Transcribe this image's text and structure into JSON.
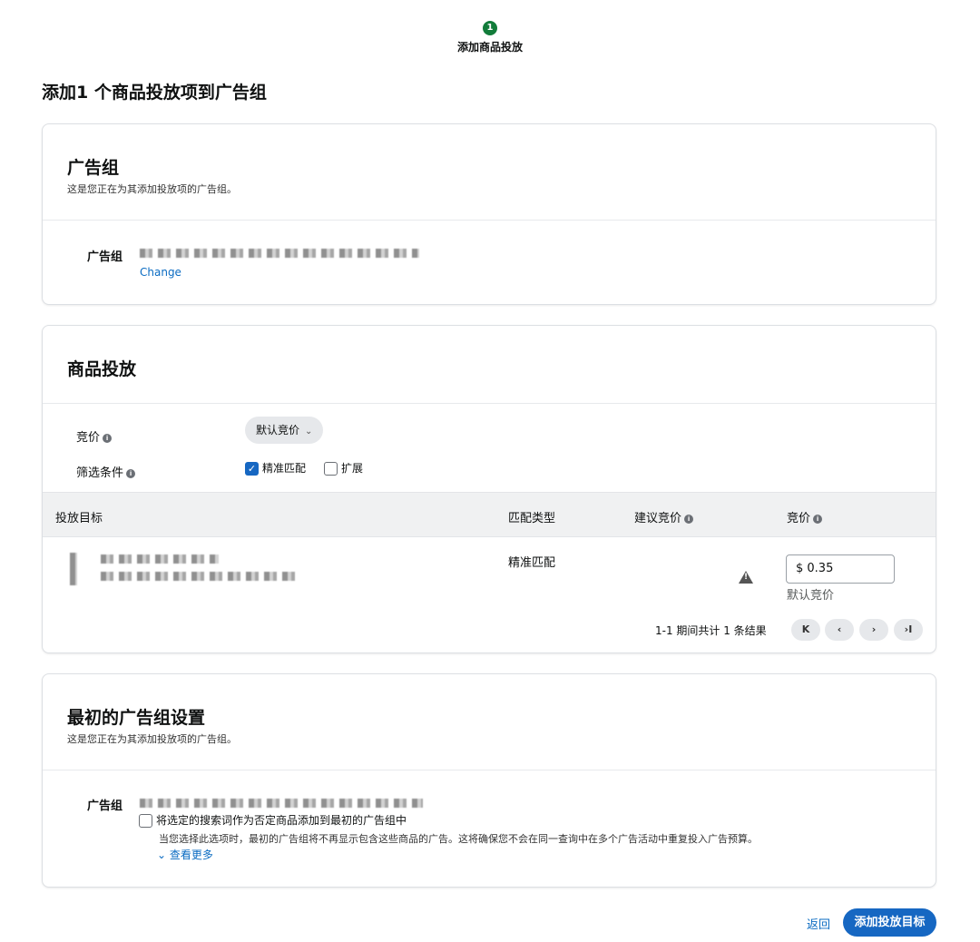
{
  "stepper": {
    "number": "1",
    "label": "添加商品投放"
  },
  "page_title": "添加1 个商品投放项到广告组",
  "ad_group_card": {
    "title": "广告组",
    "subtitle": "这是您正在为其添加投放项的广告组。",
    "field_label": "广告组",
    "change_link": "Change"
  },
  "targeting_card": {
    "title": "商品投放",
    "bid_label": "竞价",
    "bid_select": "默认竞价",
    "filter_label": "筛选条件",
    "filter_exact": "精准匹配",
    "filter_expanded": "扩展",
    "table": {
      "headers": [
        "投放目标",
        "匹配类型",
        "建议竞价",
        "竞价"
      ],
      "rows": [
        {
          "match_type": "精准匹配",
          "bid_value": "$  0.35",
          "bid_note": "默认竞价"
        }
      ]
    },
    "pagination": {
      "summary": "1-1 期间共计 1 条结果",
      "first": "K",
      "prev": "‹",
      "next": "›",
      "last": "›I"
    }
  },
  "original_card": {
    "title": "最初的广告组设置",
    "subtitle": "这是您正在为其添加投放项的广告组。",
    "field_label": "广告组",
    "checkbox_label": "将选定的搜索词作为否定商品添加到最初的广告组中",
    "checkbox_help": "当您选择此选项时，最初的广告组将不再显示包含这些商品的广告。这将确保您不会在同一查询中在多个广告活动中重复投入广告预算。",
    "see_more": "查看更多"
  },
  "footer": {
    "back": "返回",
    "submit": "添加投放目标"
  },
  "colors": {
    "accent": "#1667c2",
    "step": "#127c3a",
    "link": "#0a6bc2"
  }
}
